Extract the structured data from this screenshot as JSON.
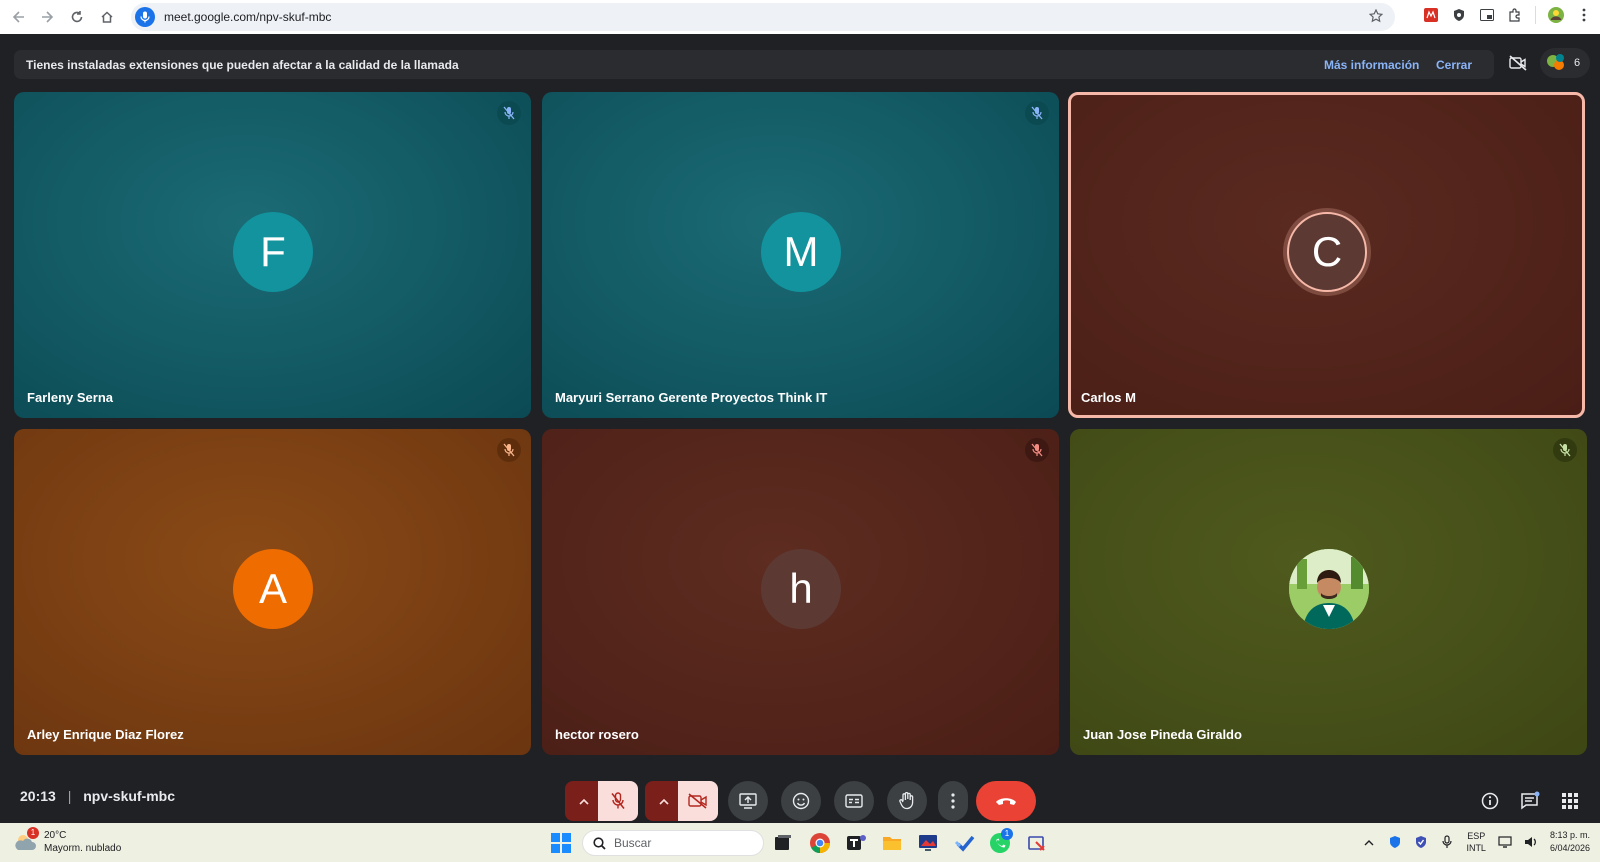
{
  "browser": {
    "url": "meet.google.com/npv-skuf-mbc"
  },
  "notice": {
    "text": "Tienes instaladas extensiones que pueden afectar a la calidad de la llamada",
    "more_info": "Más información",
    "close": "Cerrar"
  },
  "people_count": "6",
  "tiles": [
    {
      "initial": "F",
      "name": "Farleny Serna",
      "muted": true
    },
    {
      "initial": "M",
      "name": "Maryuri Serrano Gerente Proyectos Think IT",
      "muted": true
    },
    {
      "initial": "C",
      "name": "Carlos M",
      "muted": false,
      "speaking": true
    },
    {
      "initial": "A",
      "name": "Arley Enrique Diaz Florez",
      "muted": true
    },
    {
      "initial": "h",
      "name": "hector rosero",
      "muted": true
    },
    {
      "initial": "",
      "name": "Juan Jose Pineda Giraldo",
      "muted": true,
      "photo": true
    }
  ],
  "meeting": {
    "time": "20:13",
    "separator": "|",
    "code": "npv-skuf-mbc"
  },
  "taskbar": {
    "weather_badge": "1",
    "temperature": "20°C",
    "weather_desc": "Mayorm. nublado",
    "search_placeholder": "Buscar",
    "whatsapp_badge": "1",
    "lang_top": "ESP",
    "lang_bottom": "INTL",
    "clock_time": "8:13 p. m.",
    "clock_date": "6/04/2026"
  },
  "colors": {
    "accent": "#8ab4f8",
    "hangup": "#ea4335",
    "speaking_border": "#f6b8a8"
  }
}
